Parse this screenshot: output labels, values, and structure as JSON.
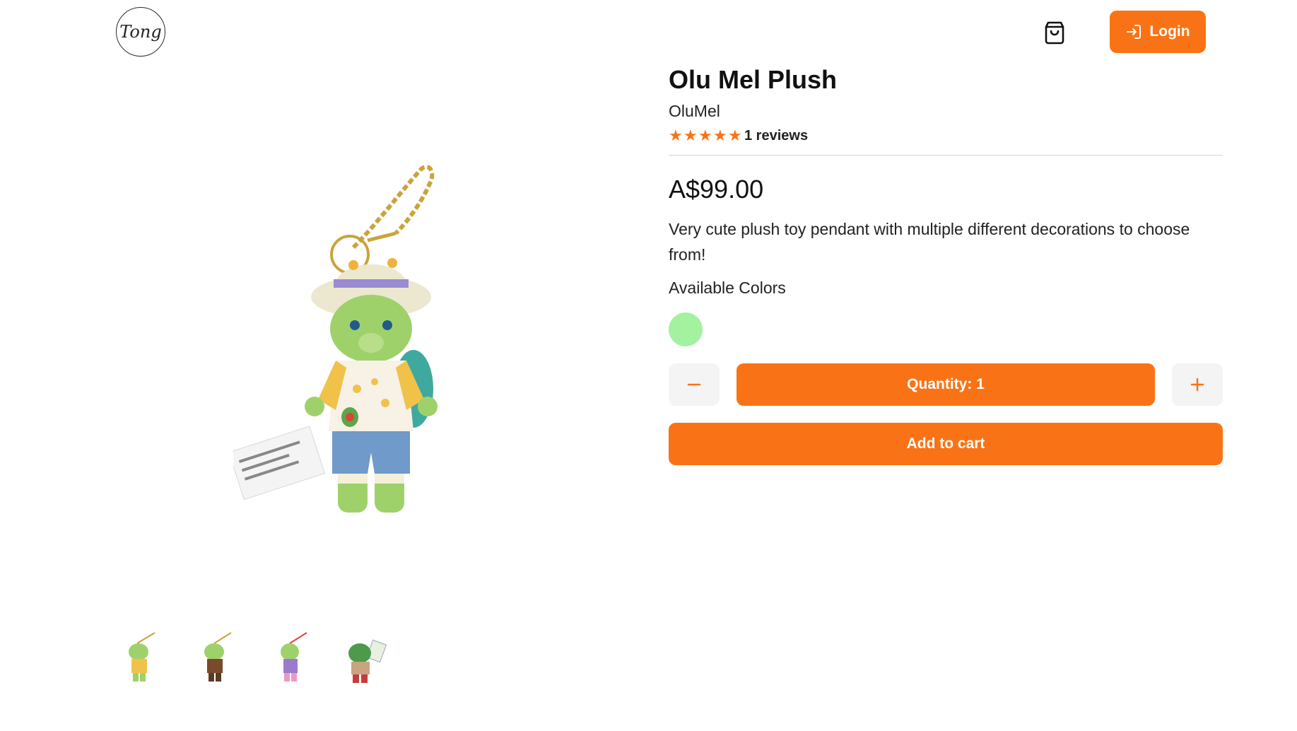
{
  "header": {
    "logo_text": "Tong",
    "cart_icon": "shopping-bag-icon",
    "login_label": "Login",
    "login_icon": "login-arrow-icon"
  },
  "colors": {
    "accent": "#f97316",
    "swatch_green": "#a3f2a0"
  },
  "product": {
    "title": "Olu Mel Plush",
    "brand": "OluMel",
    "rating": 5,
    "reviews_label": "1 reviews",
    "price": "A$99.00",
    "description": "Very cute plush toy pendant with multiple different decorations to choose from!",
    "colors_label": "Available Colors",
    "quantity_label": "Quantity: 1",
    "add_to_cart_label": "Add to cart",
    "thumbnails": [
      "yellow-outfit",
      "brown-outfit",
      "purple-outfit",
      "red-outfit"
    ]
  }
}
